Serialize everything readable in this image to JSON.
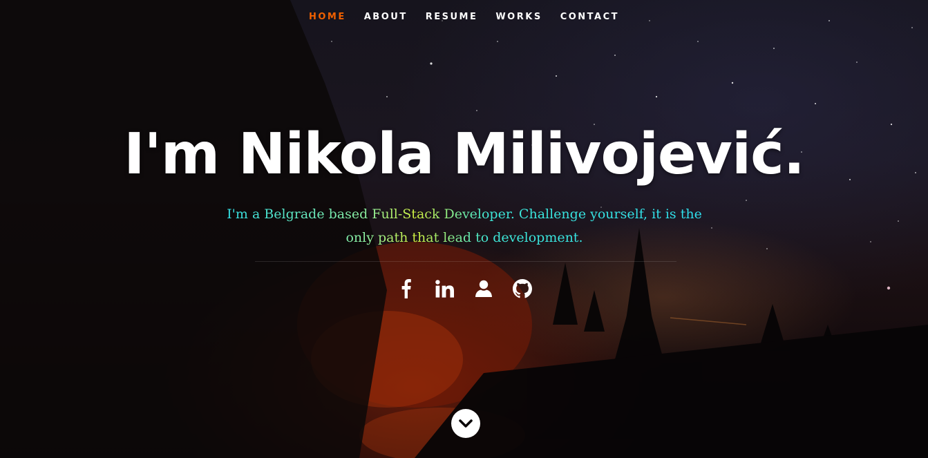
{
  "nav": {
    "items": [
      {
        "label": "HOME",
        "active": true
      },
      {
        "label": "ABOUT",
        "active": false
      },
      {
        "label": "RESUME",
        "active": false
      },
      {
        "label": "WORKS",
        "active": false
      },
      {
        "label": "CONTACT",
        "active": false
      }
    ],
    "active_color": "#f06000",
    "text_color": "#ffffff"
  },
  "hero": {
    "title": "I'm Nikola Milivojević.",
    "subtitle": "I'm a Belgrade based Full-Stack Developer. Challenge yourself, it is the only path that lead to development."
  },
  "social": {
    "icons": [
      "facebook-icon",
      "linkedin-icon",
      "user-icon",
      "github-icon"
    ]
  },
  "scroll": {
    "icon": "chevron-down-icon"
  },
  "colors": {
    "subtitle_gradient": [
      "#2fe0e8",
      "#d0f040",
      "#2ee0f0"
    ]
  }
}
